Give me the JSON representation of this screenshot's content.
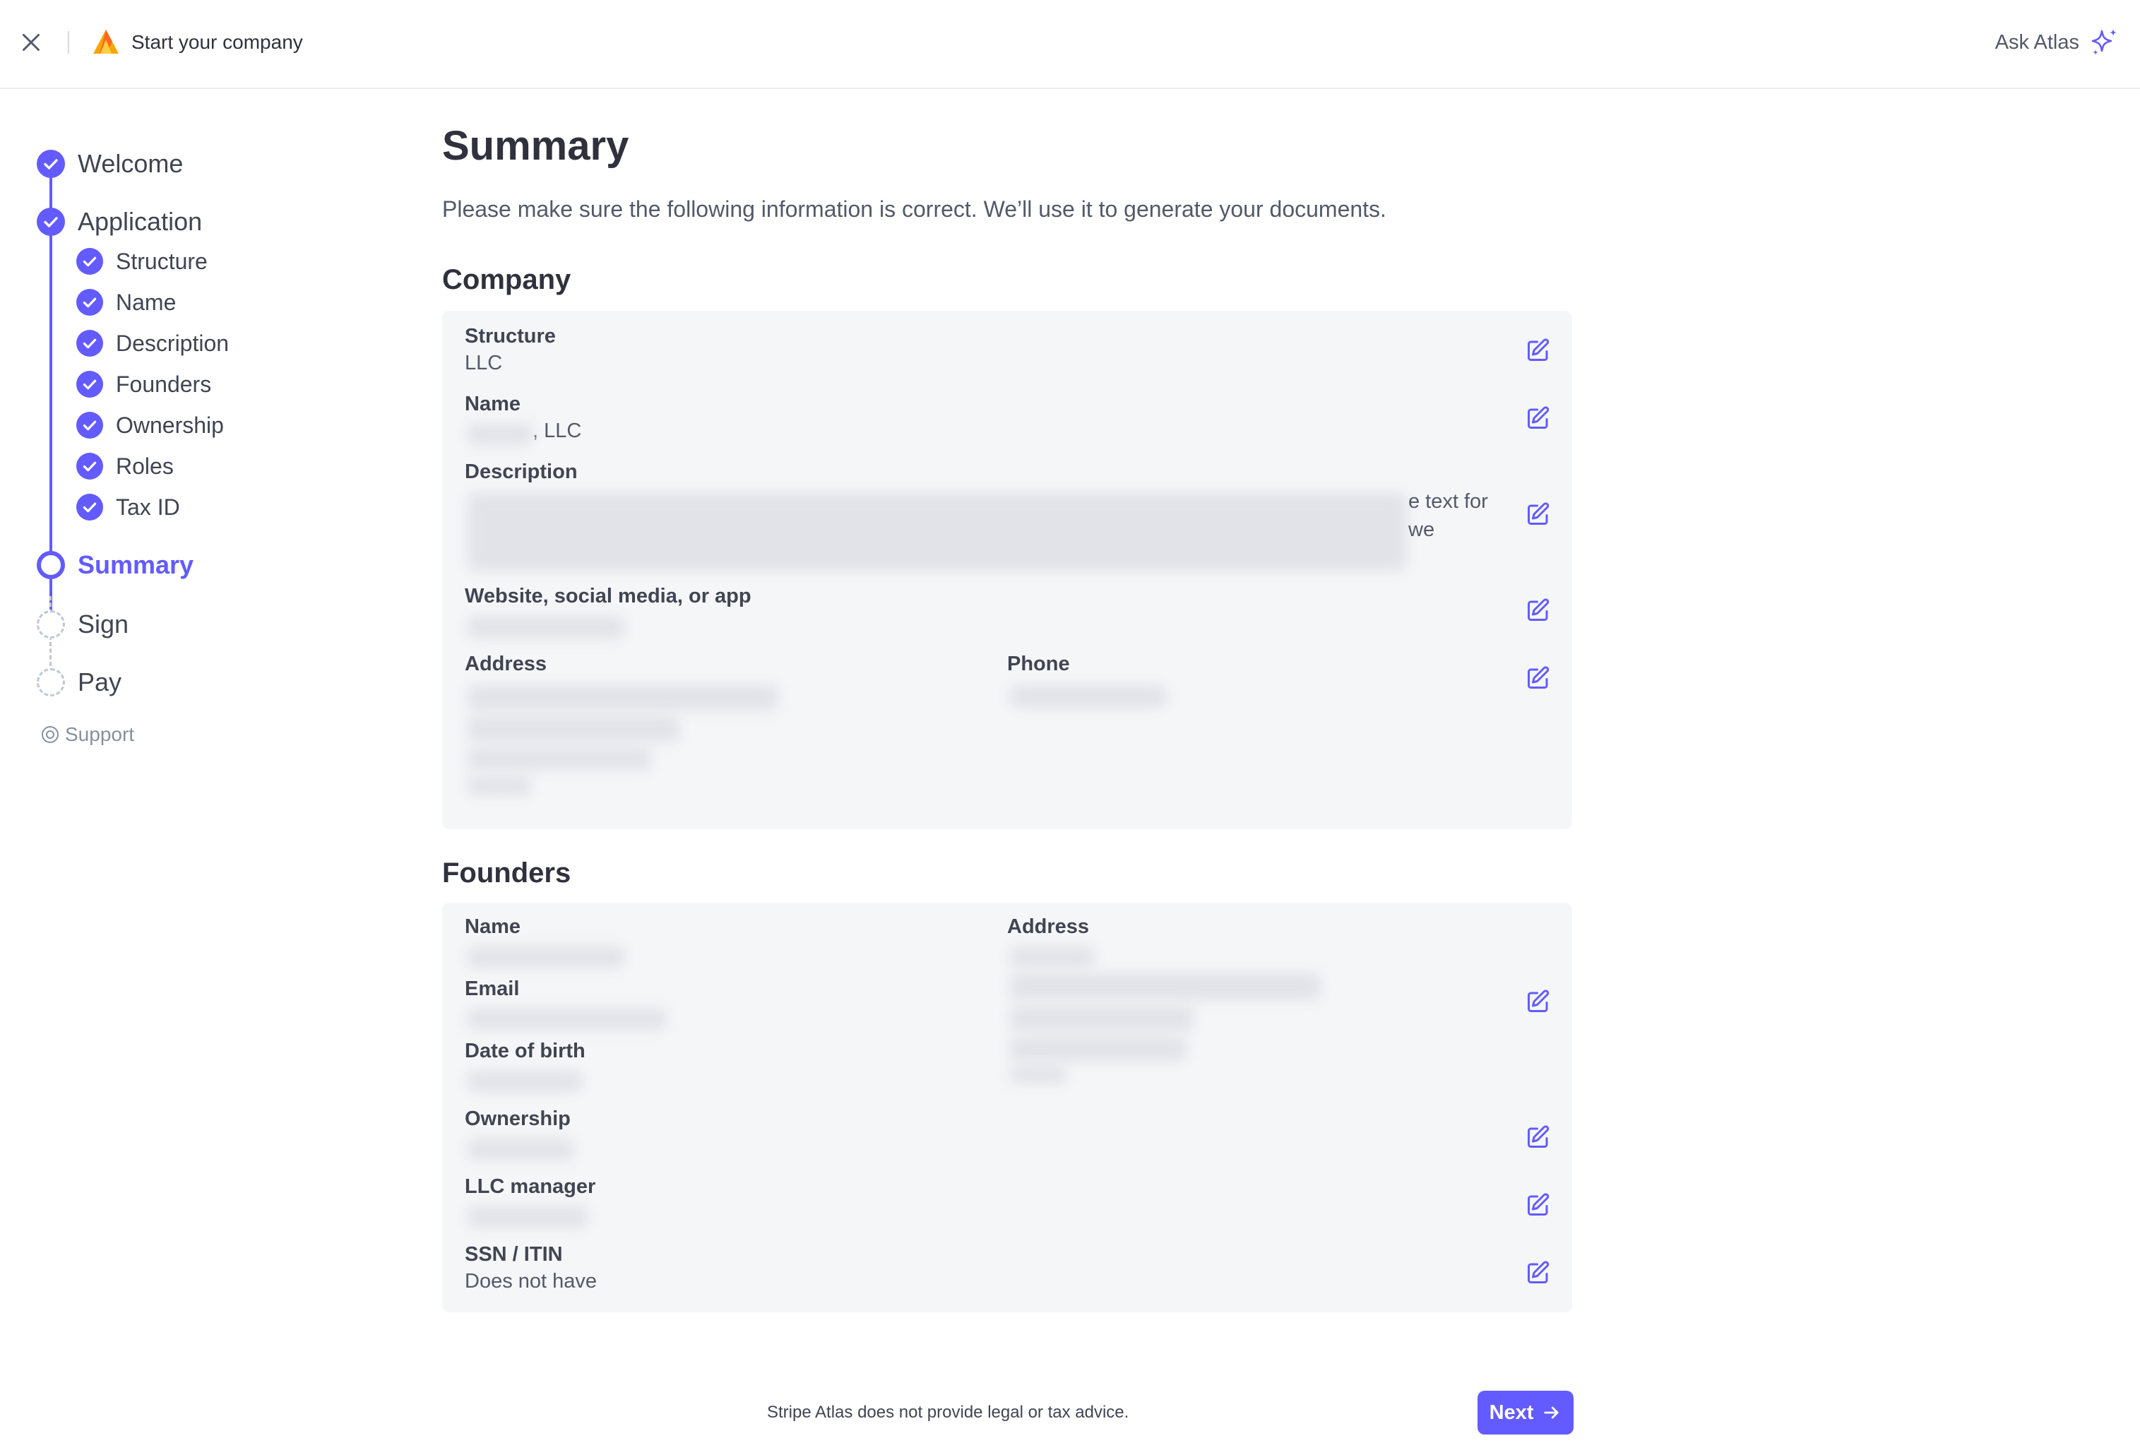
{
  "header": {
    "close_icon": "close-icon",
    "logo_icon": "atlas-logo",
    "title": "Start your company",
    "ask_atlas_label": "Ask Atlas",
    "sparkle_icon": "sparkle-icon"
  },
  "sidebar": {
    "steps": [
      {
        "label": "Welcome",
        "status": "complete"
      },
      {
        "label": "Application",
        "status": "complete"
      },
      {
        "label": "Summary",
        "status": "current"
      },
      {
        "label": "Sign",
        "status": "upcoming"
      },
      {
        "label": "Pay",
        "status": "upcoming"
      }
    ],
    "substeps": [
      {
        "label": "Structure",
        "status": "complete"
      },
      {
        "label": "Name",
        "status": "complete"
      },
      {
        "label": "Description",
        "status": "complete"
      },
      {
        "label": "Founders",
        "status": "complete"
      },
      {
        "label": "Ownership",
        "status": "complete"
      },
      {
        "label": "Roles",
        "status": "complete"
      },
      {
        "label": "Tax ID",
        "status": "complete"
      }
    ],
    "support_label": "Support"
  },
  "main": {
    "title": "Summary",
    "subtitle": "Please make sure the following information is correct. We’ll use it to generate your documents.",
    "company": {
      "heading": "Company",
      "structure_label": "Structure",
      "structure_value": "LLC",
      "name_label": "Name",
      "name_value_suffix": ", LLC",
      "description_label": "Description",
      "description_fragment_1": "e text for",
      "description_fragment_2": "we",
      "website_label": "Website, social media, or app",
      "address_label": "Address",
      "phone_label": "Phone"
    },
    "founders": {
      "heading": "Founders",
      "name_label": "Name",
      "address_label": "Address",
      "email_label": "Email",
      "dob_label": "Date of birth",
      "ownership_label": "Ownership",
      "llc_manager_label": "LLC manager",
      "ssn_label": "SSN / ITIN",
      "ssn_value": "Does not have"
    }
  },
  "footer": {
    "disclaimer": "Stripe Atlas does not provide legal or tax advice.",
    "next_label": "Next"
  },
  "colors": {
    "accent": "#635bff",
    "card_background": "#f5f6f8",
    "text_primary": "#30313d",
    "text_secondary": "#545969"
  }
}
